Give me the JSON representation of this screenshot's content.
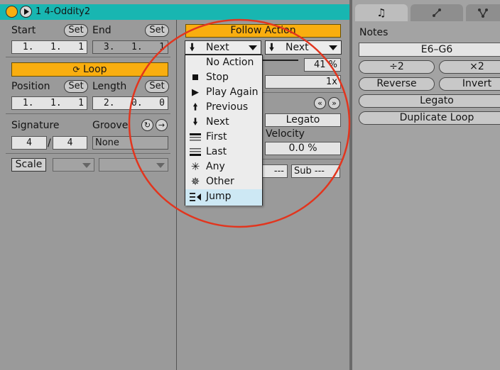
{
  "clip": {
    "name": "1 4-Oddity2",
    "start_label": "Start",
    "end_label": "End",
    "set_label": "Set",
    "start_value": "1.   1.   1",
    "end_value": "3.   1.   1",
    "loop_label": "Loop",
    "loop_icon": "loop-icon",
    "position_label": "Position",
    "length_label": "Length",
    "position_value": "1.   1.   1",
    "length_value": "2.   0.   0",
    "signature_label": "Signature",
    "groove_label": "Groove",
    "sig_numerator": "4",
    "sig_slash": "/",
    "sig_denominator": "4",
    "groove_value": "None",
    "scale_label": "Scale"
  },
  "launch": {
    "follow_action_label": "Follow Action",
    "action_a": "Next",
    "action_b": "Next",
    "chance_value": "41 %",
    "multiplier_value": "1x",
    "legato_value": "Legato",
    "velocity_label": "Velocity",
    "velocity_value": "0.0 %",
    "sub_label": "Sub ---",
    "partial_left": "---"
  },
  "dropdown": {
    "items": [
      {
        "label": "No Action",
        "icon": "none"
      },
      {
        "label": "Stop",
        "icon": "stop-icon"
      },
      {
        "label": "Play Again",
        "icon": "play-icon"
      },
      {
        "label": "Previous",
        "icon": "arrow-up-icon"
      },
      {
        "label": "Next",
        "icon": "arrow-down-icon"
      },
      {
        "label": "First",
        "icon": "first-icon"
      },
      {
        "label": "Last",
        "icon": "last-icon"
      },
      {
        "label": "Any",
        "icon": "any-icon"
      },
      {
        "label": "Other",
        "icon": "other-icon"
      },
      {
        "label": "Jump",
        "icon": "jump-icon"
      }
    ],
    "selected": "Jump"
  },
  "notes": {
    "title": "Notes",
    "range": "E6–G6",
    "half_label": "÷2",
    "double_label": "×2",
    "reverse_label": "Reverse",
    "invert_label": "Invert",
    "legato_label": "Legato",
    "duplicate_label": "Duplicate Loop"
  },
  "colors": {
    "accent": "#f9ae0f",
    "title_bar": "#18b6b1",
    "highlight": "#cde8f4",
    "annotation": "#e2351e"
  }
}
